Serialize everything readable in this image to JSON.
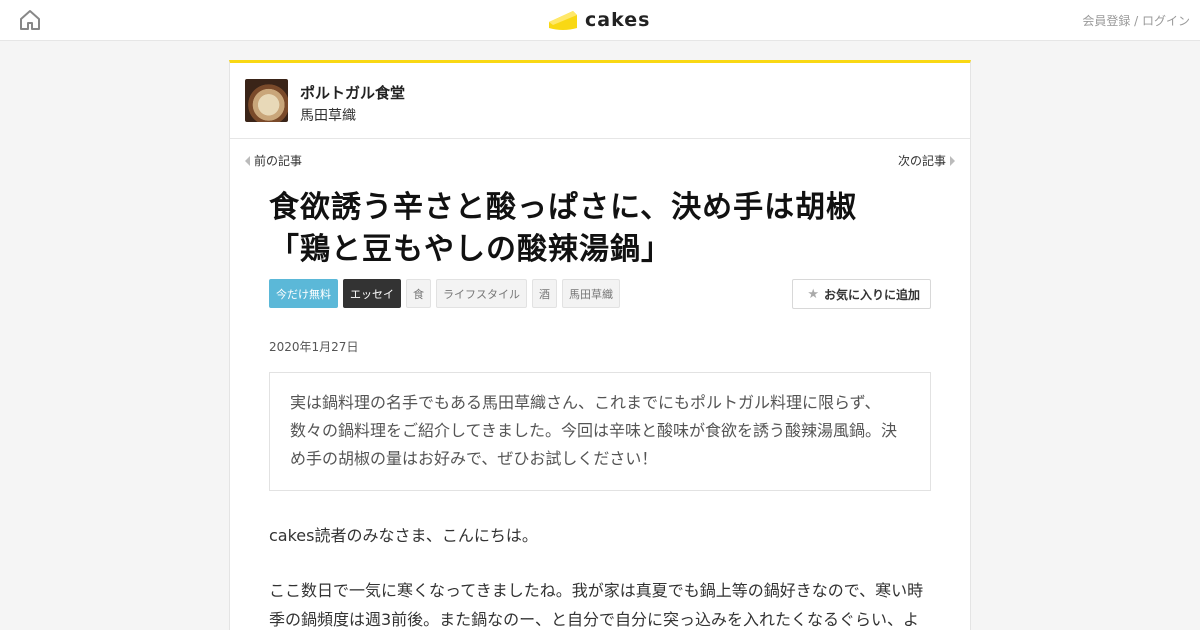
{
  "header": {
    "home_icon": "home-icon",
    "logo_text": "cakes",
    "logo_icon": "cake-slice-icon",
    "brand_color": "#f9d814",
    "account_links": "会員登録 / ログイン"
  },
  "series": {
    "title": "ポルトガル食堂",
    "author": "馬田草織"
  },
  "nav": {
    "prev": "前の記事",
    "next": "次の記事"
  },
  "article": {
    "title_line1": "食欲誘う辛さと酸っぱさに、決め手は胡椒",
    "title_line2": "「鶏と豆もやしの酸辣湯鍋」",
    "tags": [
      "今だけ無料",
      "エッセイ",
      "食",
      "ライフスタイル",
      "酒",
      "馬田草織"
    ],
    "favorite_label": "お気に入りに追加",
    "date": "2020年1月27日",
    "lead": "実は鍋料理の名手でもある馬田草織さん、これまでにもポルトガル料理に限らず、数々の鍋料理をご紹介してきました。今回は辛味と酸味が食欲を誘う酸辣湯風鍋。決め手の胡椒の量はお好みで、ぜひお試しください！",
    "paragraph1": "cakes読者のみなさま、こんにちは。",
    "paragraph2": "ここ数日で一気に寒くなってきましたね。我が家は真夏でも鍋上等の鍋好きなので、寒い時季の鍋頻度は週3前後。また鍋なのー、と自分で自分に突っ込みを入れたくなるぐらい、よ"
  },
  "colors": {
    "free_tag": "#5bb8d8",
    "essay_tag": "#333333"
  }
}
